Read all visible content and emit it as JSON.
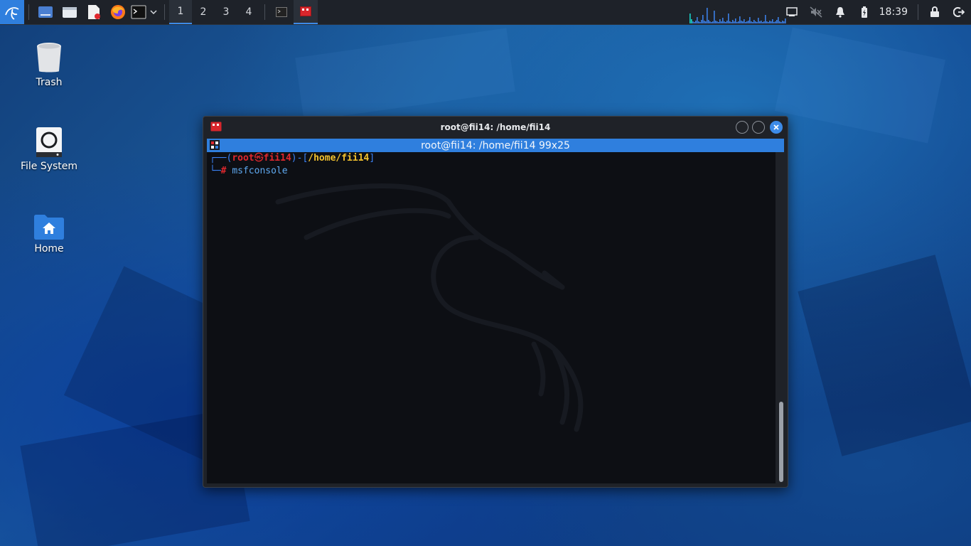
{
  "taskbar": {
    "workspaces": [
      "1",
      "2",
      "3",
      "4"
    ],
    "active_workspace": "1",
    "clock": "18:39",
    "accent_color": "#3d8be8"
  },
  "desktop_icons": [
    {
      "label": "Trash",
      "icon": "trash-icon"
    },
    {
      "label": "File System",
      "icon": "drive-icon"
    },
    {
      "label": "Home",
      "icon": "home-folder-icon"
    }
  ],
  "terminal": {
    "window_title": "root@fii14: /home/fii14",
    "tab_title": "root@fii14: /home/fii14 99x25",
    "prompt": {
      "corner_top": "┌──",
      "open_paren": "(",
      "user": "root",
      "at_symbol": "㉿",
      "host": "fii14",
      "close_paren": ")",
      "dash": "-",
      "open_bracket": "[",
      "path": "/home/fii14",
      "close_bracket": "]",
      "corner_bottom": "└─",
      "hash": "#",
      "command": "msfconsole"
    },
    "colors": {
      "frame": "#3b82f6",
      "user_host": "#e0282e",
      "path": "#f2c12e",
      "command": "#5fa9f0",
      "background": "#0d0f14"
    }
  }
}
